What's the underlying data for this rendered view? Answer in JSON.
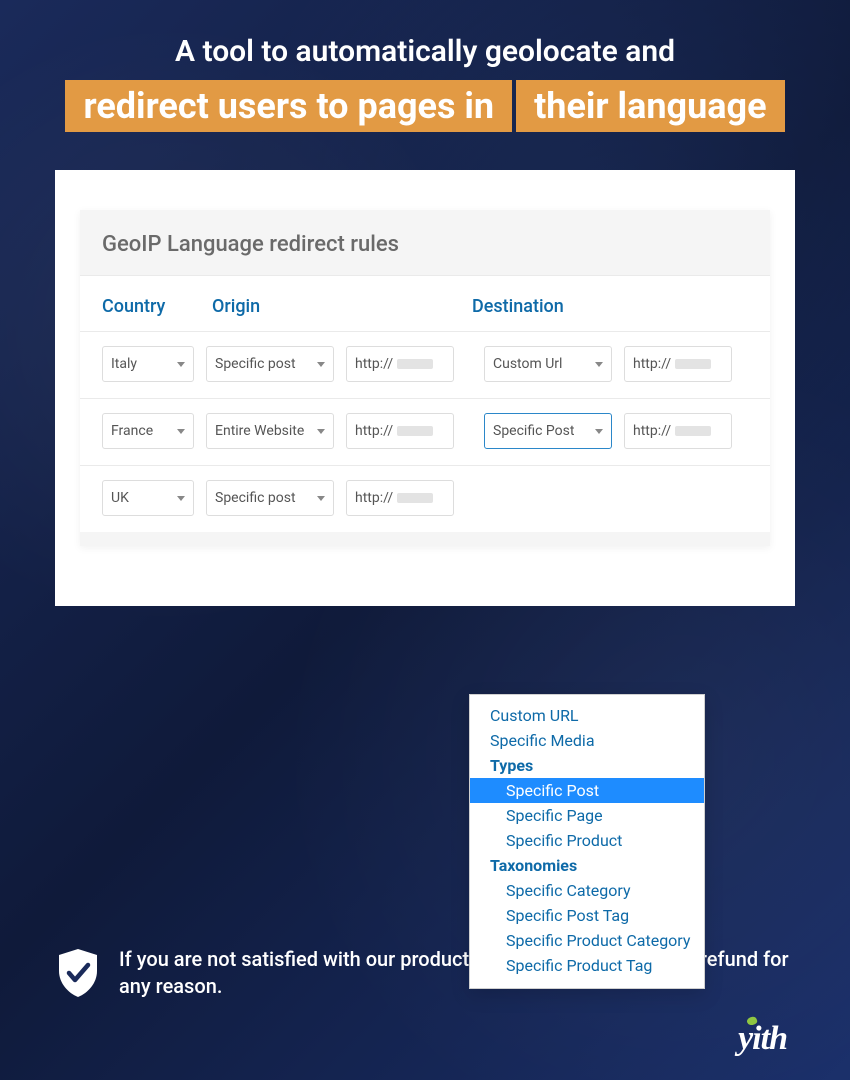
{
  "hero": {
    "line1": "A tool to automatically geolocate and",
    "highlight1": "redirect users to pages in",
    "highlight2": "their language"
  },
  "panel": {
    "title": "GeoIP Language redirect rules",
    "headers": {
      "country": "Country",
      "origin": "Origin",
      "destination": "Destination"
    },
    "rows": [
      {
        "country": "Italy",
        "origin_type": "Specific post",
        "origin_url": "http://",
        "dest_type": "Custom Url",
        "dest_url": "http://"
      },
      {
        "country": "France",
        "origin_type": "Entire Website",
        "origin_url": "http://",
        "dest_type": "Specific Post",
        "dest_url": "http://"
      },
      {
        "country": "UK",
        "origin_type": "Specific post",
        "origin_url": "http://",
        "dest_type": "",
        "dest_url": ""
      }
    ]
  },
  "dropdown": {
    "items": [
      {
        "label": "Custom URL",
        "type": "item"
      },
      {
        "label": "Specific Media",
        "type": "item"
      },
      {
        "label": "Types",
        "type": "group"
      },
      {
        "label": "Specific Post",
        "type": "sub",
        "selected": true
      },
      {
        "label": "Specific Page",
        "type": "sub"
      },
      {
        "label": "Specific Product",
        "type": "sub"
      },
      {
        "label": "Taxonomies",
        "type": "group"
      },
      {
        "label": "Specific Category",
        "type": "sub"
      },
      {
        "label": "Specific Post Tag",
        "type": "sub"
      },
      {
        "label": "Specific Product Category",
        "type": "sub"
      },
      {
        "label": "Specific Product Tag",
        "type": "sub"
      }
    ]
  },
  "footer": {
    "refund_text": "If you are not satisfied with our products, you will receive a 100% refund for any reason.",
    "brand": "yith"
  }
}
